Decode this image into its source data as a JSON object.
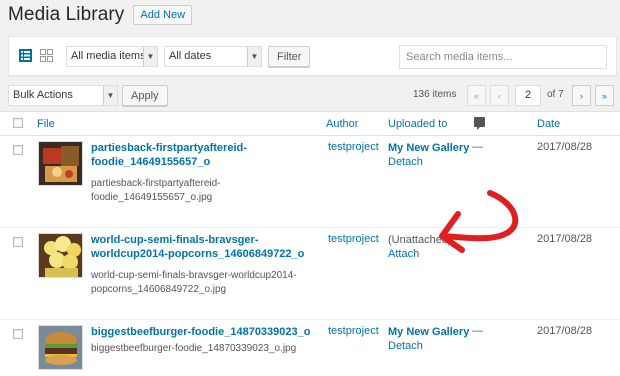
{
  "header": {
    "title": "Media Library",
    "add_new": "Add New"
  },
  "filters": {
    "type_select": "All media items",
    "date_select": "All dates",
    "filter_button": "Filter",
    "search_placeholder": "Search media items..."
  },
  "bulk": {
    "select": "Bulk Actions",
    "apply": "Apply"
  },
  "pagination": {
    "count": "136 items",
    "first": "«",
    "prev": "‹",
    "current": "2",
    "of": "of 7",
    "next": "›",
    "last": "»"
  },
  "columns": {
    "file": "File",
    "author": "Author",
    "uploaded_to": "Uploaded to",
    "date": "Date"
  },
  "rows": [
    {
      "title": "partiesback-firstpartyaftereid-foodie_14649155657_o",
      "filename": "partiesback-firstpartyaftereid-foodie_14649155657_o.jpg",
      "author": "testproject",
      "uploaded": "My New Gallery",
      "action": "Detach",
      "comments": "—",
      "date": "2017/08/28"
    },
    {
      "title": "world-cup-semi-finals-bravsger-worldcup2014-popcorns_14606849722_o",
      "filename": "world-cup-semi-finals-bravsger-worldcup2014-popcorns_14606849722_o.jpg",
      "author": "testproject",
      "uploaded": "(Unattached)",
      "action": "Attach",
      "comments": "",
      "date": "2017/08/28"
    },
    {
      "title": "biggestbeefburger-foodie_14870339023_o",
      "filename": "biggestbeefburger-foodie_14870339023_o.jpg",
      "author": "testproject",
      "uploaded": "My New Gallery",
      "action": "Detach",
      "comments": "—",
      "date": "2017/08/28"
    }
  ],
  "colors": {
    "link": "#0073aa",
    "annotation": "#e02020"
  },
  "icons": [
    "list-view-icon",
    "grid-view-icon",
    "comment-bubble-icon",
    "annotation-arrow"
  ]
}
